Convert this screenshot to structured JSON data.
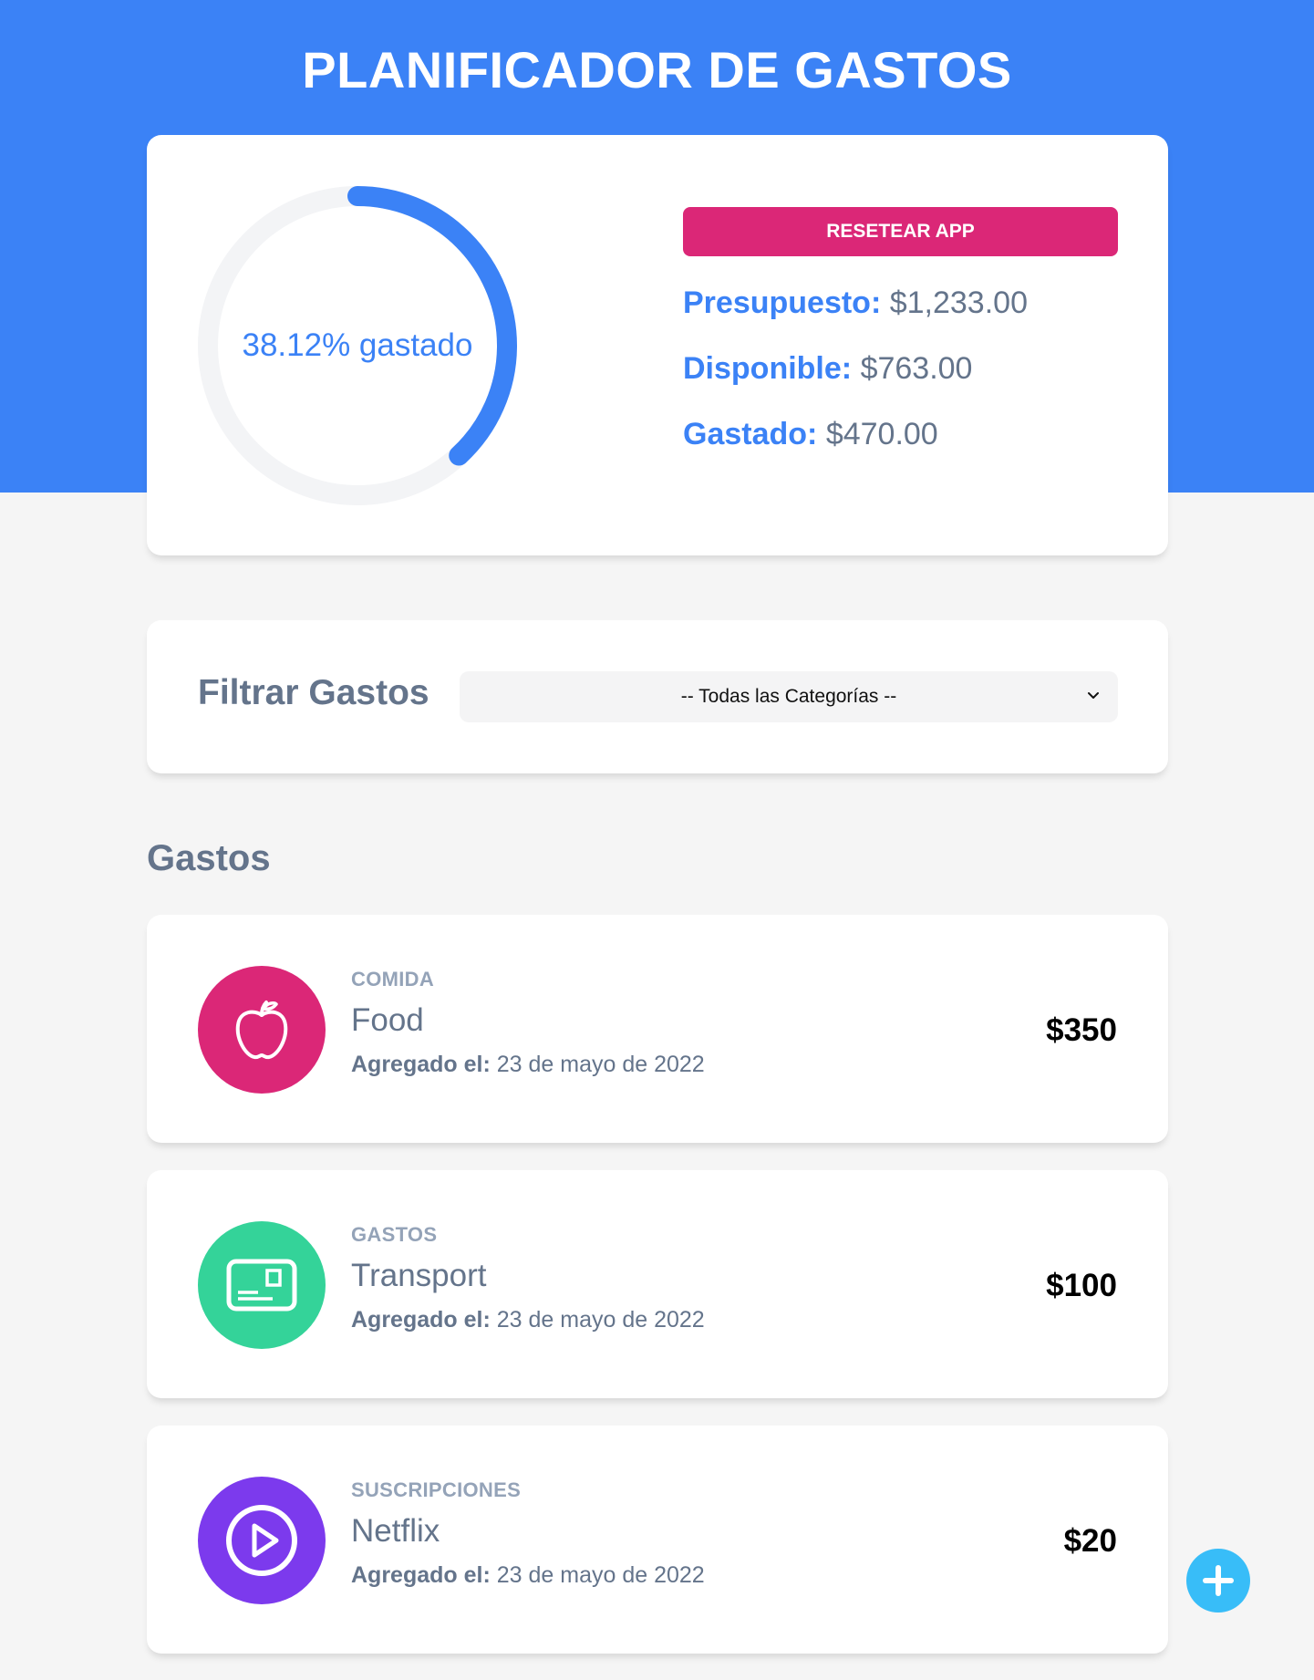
{
  "header": {
    "title": "PLANIFICADOR DE GASTOS",
    "color": "#3b82f6"
  },
  "budget": {
    "progress_label": "38.12% gastado",
    "progress_percent": 38.12,
    "reset_label": "RESETEAR APP",
    "presupuesto_label": "Presupuesto:",
    "presupuesto_value": "$1,233.00",
    "disponible_label": "Disponible:",
    "disponible_value": "$763.00",
    "gastado_label": "Gastado:",
    "gastado_value": "$470.00"
  },
  "filter": {
    "label": "Filtrar Gastos",
    "selected": "-- Todas las Categorías --"
  },
  "expenses": {
    "title": "Gastos",
    "date_label": "Agregado el:",
    "items": [
      {
        "category": "COMIDA",
        "name": "Food",
        "date": "23 de mayo de 2022",
        "amount": "$350",
        "icon": "apple-icon",
        "color": "#db2777"
      },
      {
        "category": "GASTOS",
        "name": "Transport",
        "date": "23 de mayo de 2022",
        "amount": "$100",
        "icon": "card-icon",
        "color": "#34d399"
      },
      {
        "category": "SUSCRIPCIONES",
        "name": "Netflix",
        "date": "23 de mayo de 2022",
        "amount": "$20",
        "icon": "play-icon",
        "color": "#7c3aed"
      }
    ]
  },
  "fab": {
    "icon": "plus-icon"
  }
}
